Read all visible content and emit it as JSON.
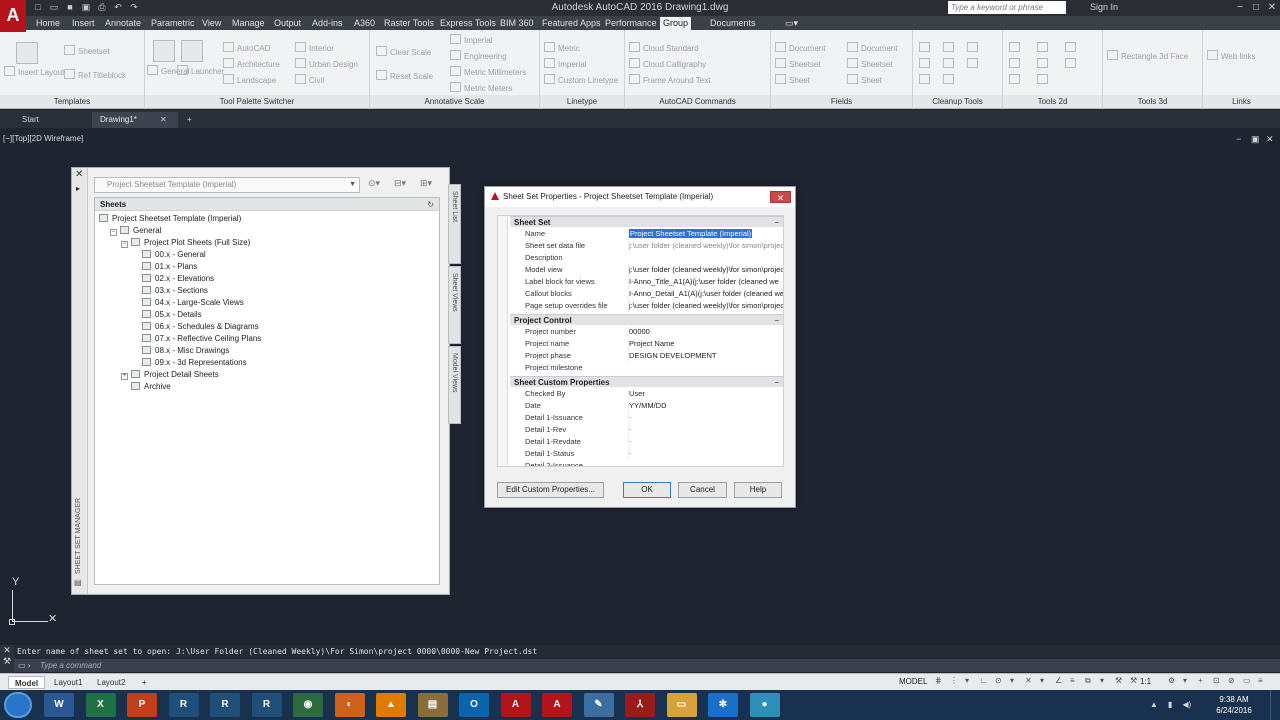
{
  "app": {
    "title": "Autodesk AutoCAD 2016    Drawing1.dwg",
    "logo": "A",
    "search_placeholder": "Type a keyword or phrase",
    "sign_in": "Sign In"
  },
  "ribbon_tabs": [
    "Home",
    "Insert",
    "Annotate",
    "Parametric",
    "View",
    "Manage",
    "Output",
    "Add-ins",
    "A360",
    "Raster Tools",
    "Express Tools",
    "BIM 360",
    "Featured Apps",
    "Performance",
    "Group",
    "Documents"
  ],
  "active_tab": "Group",
  "ribbon": {
    "templates": {
      "name": "Templates",
      "insert_layout": "Insert Layout",
      "sheetset": "Sheetset",
      "ref_titleblock": "Ref Titleblock"
    },
    "tool_palette": {
      "name": "Tool Palette Switcher",
      "general": "General",
      "launcher": "Launcher",
      "autocad": "AutoCAD",
      "architecture": "Architecture",
      "landscape": "Landscape",
      "interior": "Interior",
      "urban_design": "Urban Design",
      "civil": "Civil"
    },
    "annotative_scale": {
      "name": "Annotative Scale",
      "clear_scale": "Clear Scale",
      "reset_scale": "Reset Scale",
      "imperial": "Imperial",
      "engineering": "Engineering",
      "metric_millimeters": "Metric Millimeters",
      "metric_meters": "Metric Meters"
    },
    "linetype": {
      "name": "Linetype",
      "metric": "Metric",
      "imperial": "Imperial",
      "custom_linetype": "Custom Linetype"
    },
    "autocad_commands": {
      "name": "AutoCAD Commands",
      "cloud_standard": "Cloud Standard",
      "cloud_calligraphy": "Cloud Calligraphy",
      "frame_around_text": "Frame Around Text"
    },
    "fields": {
      "name": "Fields",
      "document": "Document",
      "sheetset": "Sheetset",
      "sheet": "Sheet",
      "document2": "Document",
      "sheetset2": "Sheetset",
      "sheet2": "Sheet"
    },
    "cleanup": {
      "name": "Cleanup Tools"
    },
    "tools2d": {
      "name": "Tools 2d"
    },
    "tools3d": {
      "name": "Tools 3d",
      "rectangle_3d_face": "Rectangle 3d Face"
    },
    "links": {
      "name": "Links",
      "web_links": "Web links"
    }
  },
  "file_tabs": [
    "Start",
    "Drawing1*"
  ],
  "viewport": {
    "label": "[−][Top][2D Wireframe]"
  },
  "ssm": {
    "palette_title": "SHEET SET MANAGER",
    "combo": "Project Sheetset Template (Imperial)",
    "tree_header": "Sheets",
    "side_tabs": [
      "Sheet List",
      "Sheet Views",
      "Model Views"
    ],
    "tree": [
      {
        "label": "Project Sheetset Template (Imperial)",
        "level": 0
      },
      {
        "label": "General",
        "level": 1,
        "toggle": "−"
      },
      {
        "label": "Project Plot Sheets (Full Size)",
        "level": 2,
        "toggle": "−"
      },
      {
        "label": "00.x - General",
        "level": 3
      },
      {
        "label": "01.x - Plans",
        "level": 3
      },
      {
        "label": "02.x - Elevations",
        "level": 3
      },
      {
        "label": "03.x - Sections",
        "level": 3
      },
      {
        "label": "04.x - Large-Scale Views",
        "level": 3
      },
      {
        "label": "05.x - Details",
        "level": 3
      },
      {
        "label": "06.x - Schedules & Diagrams",
        "level": 3
      },
      {
        "label": "07.x - Reflective Ceiling Plans",
        "level": 3
      },
      {
        "label": "08.x - Misc Drawings",
        "level": 3
      },
      {
        "label": "09.x - 3d Representations",
        "level": 3
      },
      {
        "label": "Project Detail Sheets",
        "level": 2,
        "toggle": "+"
      },
      {
        "label": "Archive",
        "level": 2
      }
    ]
  },
  "dialog": {
    "title": "Sheet Set Properties - Project Sheetset Template (Imperial)",
    "close": "✕",
    "sections": [
      {
        "name": "Sheet Set",
        "rows": [
          {
            "k": "Name",
            "v": "Project Sheetset Template (Imperial)",
            "selected": true
          },
          {
            "k": "Sheet set data file",
            "v": "j:\\user folder (cleaned weekly)\\for simon\\project",
            "dim": true
          },
          {
            "k": "Description",
            "v": ""
          },
          {
            "k": "Model view",
            "v": "j:\\user folder (cleaned weekly)\\for simon\\project"
          },
          {
            "k": "Label block for views",
            "v": "I-Anno_Title_A1(A)(j:\\user folder (cleaned we"
          },
          {
            "k": "Callout blocks",
            "v": "I-Anno_Detail_A1(A)(j:\\user folder (cleaned we"
          },
          {
            "k": "Page setup overrides file",
            "v": "j:\\user folder (cleaned weekly)\\for simon\\project"
          }
        ]
      },
      {
        "name": "Project Control",
        "rows": [
          {
            "k": "Project number",
            "v": "00000"
          },
          {
            "k": "Project name",
            "v": "Project Name"
          },
          {
            "k": "Project phase",
            "v": "DESIGN DEVELOPMENT"
          },
          {
            "k": "Project milestone",
            "v": ""
          }
        ]
      },
      {
        "name": "Sheet Custom Properties",
        "rows": [
          {
            "k": "Checked By",
            "v": "User"
          },
          {
            "k": "Date",
            "v": "YY/MM/DD"
          },
          {
            "k": "Detail 1-Issuance",
            "v": "-",
            "dim": true
          },
          {
            "k": "Detail 1-Rev",
            "v": "-",
            "dim": true
          },
          {
            "k": "Detail 1-Revdate",
            "v": "-",
            "dim": true
          },
          {
            "k": "Detail 1-Status",
            "v": "-",
            "dim": true
          },
          {
            "k": "Detail 2-Issuance",
            "v": ""
          }
        ]
      }
    ],
    "buttons": {
      "edit": "Edit Custom Properties...",
      "ok": "OK",
      "cancel": "Cancel",
      "help": "Help"
    }
  },
  "command": {
    "history": "Enter name of sheet set to open: J:\\User Folder (Cleaned Weekly)\\For Simon\\project 0000\\0000-New Project.dst",
    "placeholder": "Type a command"
  },
  "status": {
    "layouts": [
      "Model",
      "Layout1",
      "Layout2"
    ],
    "model_label": "MODEL",
    "scale": "1:1"
  },
  "taskbar": {
    "time": "9:38 AM",
    "date": "6/24/2016",
    "apps": [
      {
        "name": "word",
        "glyph": "W",
        "color": "#2b5797"
      },
      {
        "name": "excel",
        "glyph": "X",
        "color": "#1e7145"
      },
      {
        "name": "powerpoint",
        "glyph": "P",
        "color": "#c43e1c"
      },
      {
        "name": "revit",
        "glyph": "R",
        "color": "#1f4e79"
      },
      {
        "name": "revit2",
        "glyph": "R",
        "color": "#1f4e79"
      },
      {
        "name": "revit3",
        "glyph": "R",
        "color": "#1f4e79"
      },
      {
        "name": "chrome",
        "glyph": "◉",
        "color": "#2d6a3e"
      },
      {
        "name": "firefox",
        "glyph": "◐",
        "color": "#d0611a"
      },
      {
        "name": "vlc",
        "glyph": "▲",
        "color": "#e07b00"
      },
      {
        "name": "files",
        "glyph": "▤",
        "color": "#8a6d3b"
      },
      {
        "name": "outlook",
        "glyph": "O",
        "color": "#0a64ad"
      },
      {
        "name": "autocad",
        "glyph": "A",
        "color": "#b3131a"
      },
      {
        "name": "autocad2",
        "glyph": "A",
        "color": "#b3131a"
      },
      {
        "name": "paint",
        "glyph": "✎",
        "color": "#3c6e9f"
      },
      {
        "name": "acrobat",
        "glyph": "⅄",
        "color": "#9b1b1b"
      },
      {
        "name": "explorer",
        "glyph": "▭",
        "color": "#d8a23a"
      },
      {
        "name": "snowflake",
        "glyph": "✻",
        "color": "#1a6fc9"
      },
      {
        "name": "globe",
        "glyph": "●",
        "color": "#2e8fb8"
      }
    ]
  }
}
